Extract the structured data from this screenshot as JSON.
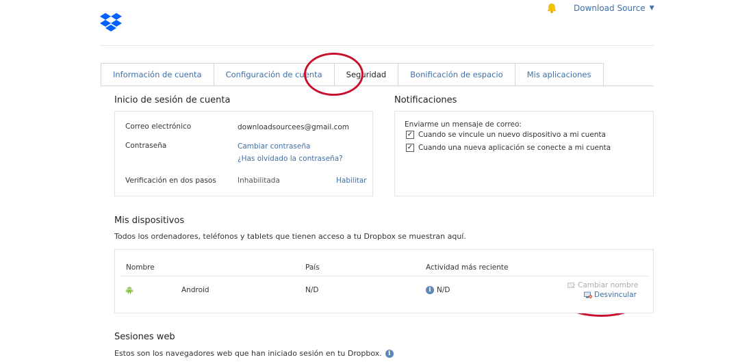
{
  "header": {
    "user_name": "Download Source",
    "caret": "▼",
    "brand_color": "#0061fe"
  },
  "tabs": [
    {
      "label": "Información de cuenta",
      "active": false
    },
    {
      "label": "Configuración de cuenta",
      "active": false
    },
    {
      "label": "Seguridad",
      "active": true
    },
    {
      "label": "Bonificación de espacio",
      "active": false
    },
    {
      "label": "Mis aplicaciones",
      "active": false
    }
  ],
  "login": {
    "title": "Inicio de sesión de cuenta",
    "email_label": "Correo electrónico",
    "email_value": "downloadsourcees@gmail.com",
    "password_label": "Contraseña",
    "change_password": "Cambiar contraseña",
    "forgot_password": "¿Has olvidado la contraseña?",
    "two_step_label": "Verificación en dos pasos",
    "two_step_status": "Inhabilitada",
    "enable_link": "Habilitar"
  },
  "notifications": {
    "title": "Notificaciones",
    "heading": "Enviarme un mensaje de correo:",
    "options": [
      {
        "label": "Cuando se vincule un nuevo dispositivo a mi cuenta",
        "checked": true
      },
      {
        "label": "Cuando una nueva aplicación se conecte a mi cuenta",
        "checked": true
      }
    ]
  },
  "devices": {
    "title": "Mis dispositivos",
    "description": "Todos los ordenadores, teléfonos y tablets que tienen acceso a tu Dropbox se muestran aquí.",
    "columns": [
      "Nombre",
      "País",
      "Actividad más reciente"
    ],
    "rows": [
      {
        "icon": "android-icon",
        "name": "Android",
        "country": "N/D",
        "activity": "N/D"
      }
    ],
    "rename_label": "Cambiar nombre",
    "unlink_label": "Desvincular"
  },
  "web_sessions": {
    "title": "Sesiones web",
    "description": "Estos son los navegadores web que han iniciado sesión en tu Dropbox."
  },
  "annotation_color": "#c8102e"
}
